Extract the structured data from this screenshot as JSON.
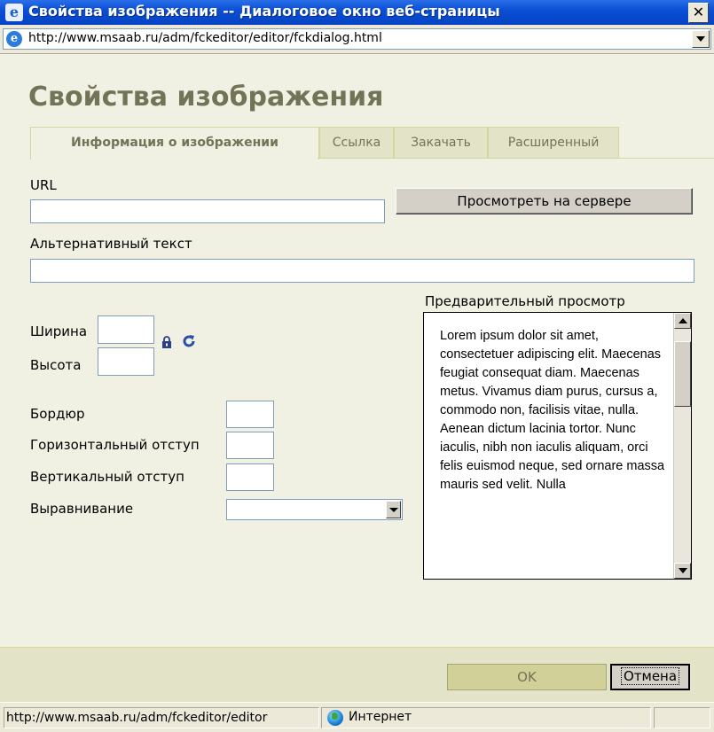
{
  "window": {
    "title": "Свойства изображения -- Диалоговое окно веб-страницы",
    "address": "http://www.msaab.ru/adm/fckeditor/editor/fckdialog.html"
  },
  "dialog": {
    "title": "Свойства изображения",
    "tabs": [
      {
        "label": "Информация о изображении"
      },
      {
        "label": "Ссылка"
      },
      {
        "label": "Закачать"
      },
      {
        "label": "Расширенный"
      }
    ]
  },
  "form": {
    "url_label": "URL",
    "url_value": "",
    "browse_button": "Просмотреть на сервере",
    "alt_label": "Альтернативный текст",
    "alt_value": "",
    "width_label": "Ширина",
    "height_label": "Высота",
    "border_label": "Бордюр",
    "hspace_label": "Горизонтальный отступ",
    "vspace_label": "Вертикальный отступ",
    "align_label": "Выравнивание",
    "align_value": ""
  },
  "preview": {
    "label": "Предварительный просмотр",
    "text": "Lorem ipsum dolor sit amet, consectetuer adipiscing elit. Maecenas feugiat consequat diam. Maecenas metus. Vivamus diam purus, cursus a, commodo non, facilisis vitae, nulla. Aenean dictum lacinia tortor. Nunc iaculis, nibh non iaculis aliquam, orci felis euismod neque, sed ornare massa mauris sed velit. Nulla"
  },
  "footer": {
    "ok_label": "OK",
    "cancel_label": "Отмена"
  },
  "statusbar": {
    "url": "http://www.msaab.ru/adm/fckeditor/editor",
    "zone": "Интернет"
  },
  "colors": {
    "dialog_bg": "#f1f1e3",
    "title_text": "#737357",
    "titlebar_blue": "#0a4fd6"
  }
}
